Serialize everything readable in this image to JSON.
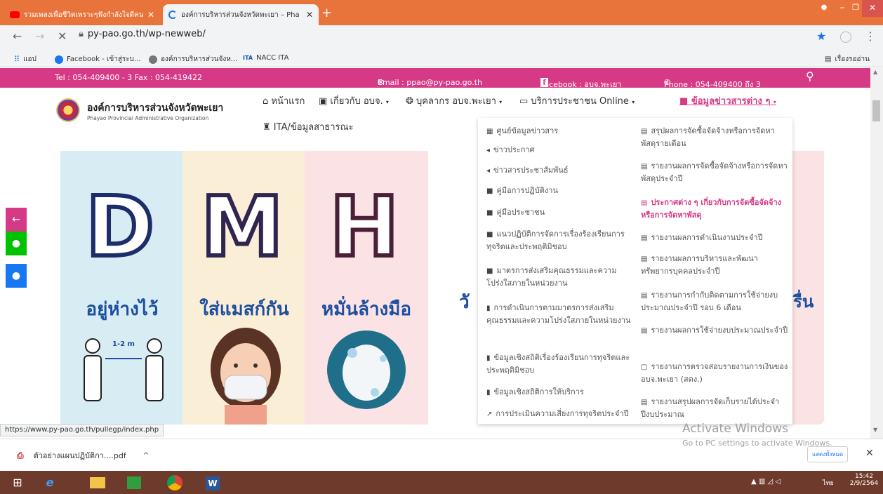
{
  "browser": {
    "tabs": [
      {
        "title": "รวมเพลงเพื่อชีวิตเพราะๆฟังกำลังใจดีคนหนั...",
        "active": false
      },
      {
        "title": "องค์การบริหารส่วนจังหวัดพะเยา – Pha",
        "active": true
      }
    ],
    "address": "py-pao.go.th/wp-newweb/",
    "bookmarks": [
      "แอป",
      "Facebook - เข้าสู่ระบ...",
      "องค์การบริหารส่วนจังห...",
      "NACC ITA"
    ],
    "bookmarks_right": "เรื่องรออ่าน"
  },
  "topbar": {
    "tel": "Tel : 054-409400 - 3   Fax : 054-419422",
    "email": "Email : ppao@py-pao.go.th",
    "facebook": "Facebook : อบจ.พะเยา",
    "phone": "Phone : 054-409400 ถึง 3"
  },
  "site": {
    "name": "องค์การบริหารส่วนจังหวัดพะเยา",
    "subtitle": "Phayao Provincial Administrative Organization",
    "menu": [
      "หน้าแรก",
      "เกี่ยวกับ อบจ.",
      "บุคลากร อบจ.พะเยา",
      "บริการประชาชน Online",
      "ข้อมูลข่าวสารต่าง ๆ",
      "ITA/ข้อมูลสาธารณะ"
    ]
  },
  "banner": {
    "cards": [
      {
        "letter": "D",
        "caption": "อยู่ห่างไว้",
        "badge": "1-2 m"
      },
      {
        "letter": "M",
        "caption": "ใส่แมสก์กัน"
      },
      {
        "letter": "H",
        "caption": "หมั่นล้างมือ"
      }
    ],
    "partial_caption": "วั",
    "partial_right": "รื่น"
  },
  "dropdown": {
    "left": [
      "ศูนย์ข้อมูลข่าวสาร",
      "ข่าวประกาศ",
      "ข่าวสารประชาสัมพันธ์",
      "คู่มือการปฏิบัติงาน",
      "คู่มือประชาชน",
      "แนวปฏิบัติการจัดการเรื่องร้องเรียนการทุจริตและประพฤติมิชอบ",
      "มาตรการส่งเสริมคุณธรรมและความโปร่งใสภายในหน่วยงาน",
      "การดำเนินการตามมาตรการส่งเสริมคุณธรรมและความโปร่งใสภายในหน่วยงาน",
      "ข้อมูลเชิงสถิติเรื่องร้องเรียนการทุจริตและประพฤติมิชอบ",
      "ข้อมูลเชิงสถิติการให้บริการ",
      "การประเมินความเสี่ยงการทุจริตประจำปี"
    ],
    "right": [
      "สรุปผลการจัดซื้อจัดจ้างหรือการจัดหาพัสดุรายเดือน",
      "รายงานผลการจัดซื้อจัดจ้างหรือการจัดหาพัสดุประจำปี",
      "ประกาศต่าง ๆ เกี่ยวกับการจัดซื้อจัดจ้างหรือการจัดหาพัสดุ",
      "รายงานผลการดำเนินงานประจำปี",
      "รายงานผลการบริหารและพัฒนาทรัพยากรบุคคลประจำปี",
      "รายงานการกำกับติดตามการใช้จ่ายงบประมาณประจำปี รอบ 6 เดือน",
      "รายงานผลการใช้จ่ายงบประมาณประจำปี",
      "รายงานการตรวจสอบรายงานการเงินของ อบจ.พะเยา (สตง.)",
      "รายงานสรุปผลการจัดเก็บรายได้ประจำปีงบประมาณ"
    ]
  },
  "status_url": "https://www.py-pao.go.th/pullegp/index.php",
  "download": {
    "filename": "ตัวอย่างแผนปฏิบัติกา....pdf",
    "show_all": "แสดงทั้งหมด"
  },
  "watermark": {
    "title": "Activate Windows",
    "subtitle": "Go to PC settings to activate Windows."
  },
  "taskbar": {
    "time": "15:42",
    "date": "2/9/2564",
    "lang": "ไทย"
  }
}
